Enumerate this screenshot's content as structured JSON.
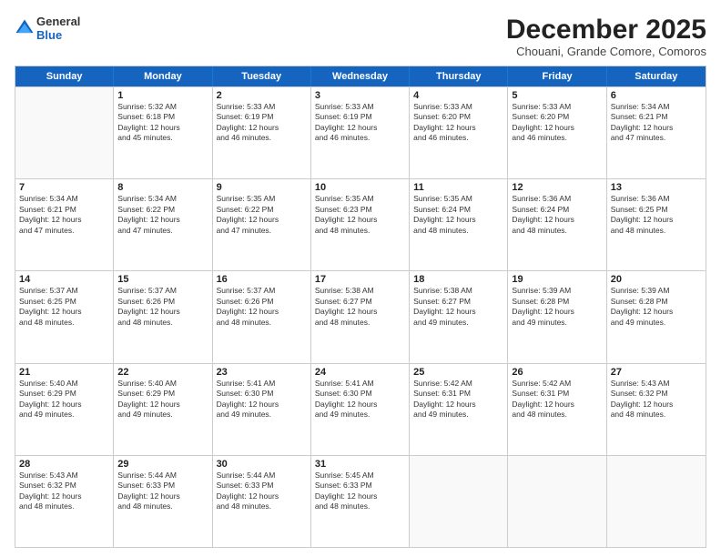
{
  "header": {
    "logo_general": "General",
    "logo_blue": "Blue",
    "main_title": "December 2025",
    "subtitle": "Chouani, Grande Comore, Comoros"
  },
  "days": [
    "Sunday",
    "Monday",
    "Tuesday",
    "Wednesday",
    "Thursday",
    "Friday",
    "Saturday"
  ],
  "rows": [
    [
      {
        "day": "",
        "content": ""
      },
      {
        "day": "1",
        "content": "Sunrise: 5:32 AM\nSunset: 6:18 PM\nDaylight: 12 hours\nand 45 minutes."
      },
      {
        "day": "2",
        "content": "Sunrise: 5:33 AM\nSunset: 6:19 PM\nDaylight: 12 hours\nand 46 minutes."
      },
      {
        "day": "3",
        "content": "Sunrise: 5:33 AM\nSunset: 6:19 PM\nDaylight: 12 hours\nand 46 minutes."
      },
      {
        "day": "4",
        "content": "Sunrise: 5:33 AM\nSunset: 6:20 PM\nDaylight: 12 hours\nand 46 minutes."
      },
      {
        "day": "5",
        "content": "Sunrise: 5:33 AM\nSunset: 6:20 PM\nDaylight: 12 hours\nand 46 minutes."
      },
      {
        "day": "6",
        "content": "Sunrise: 5:34 AM\nSunset: 6:21 PM\nDaylight: 12 hours\nand 47 minutes."
      }
    ],
    [
      {
        "day": "7",
        "content": "Sunrise: 5:34 AM\nSunset: 6:21 PM\nDaylight: 12 hours\nand 47 minutes."
      },
      {
        "day": "8",
        "content": "Sunrise: 5:34 AM\nSunset: 6:22 PM\nDaylight: 12 hours\nand 47 minutes."
      },
      {
        "day": "9",
        "content": "Sunrise: 5:35 AM\nSunset: 6:22 PM\nDaylight: 12 hours\nand 47 minutes."
      },
      {
        "day": "10",
        "content": "Sunrise: 5:35 AM\nSunset: 6:23 PM\nDaylight: 12 hours\nand 48 minutes."
      },
      {
        "day": "11",
        "content": "Sunrise: 5:35 AM\nSunset: 6:24 PM\nDaylight: 12 hours\nand 48 minutes."
      },
      {
        "day": "12",
        "content": "Sunrise: 5:36 AM\nSunset: 6:24 PM\nDaylight: 12 hours\nand 48 minutes."
      },
      {
        "day": "13",
        "content": "Sunrise: 5:36 AM\nSunset: 6:25 PM\nDaylight: 12 hours\nand 48 minutes."
      }
    ],
    [
      {
        "day": "14",
        "content": "Sunrise: 5:37 AM\nSunset: 6:25 PM\nDaylight: 12 hours\nand 48 minutes."
      },
      {
        "day": "15",
        "content": "Sunrise: 5:37 AM\nSunset: 6:26 PM\nDaylight: 12 hours\nand 48 minutes."
      },
      {
        "day": "16",
        "content": "Sunrise: 5:37 AM\nSunset: 6:26 PM\nDaylight: 12 hours\nand 48 minutes."
      },
      {
        "day": "17",
        "content": "Sunrise: 5:38 AM\nSunset: 6:27 PM\nDaylight: 12 hours\nand 48 minutes."
      },
      {
        "day": "18",
        "content": "Sunrise: 5:38 AM\nSunset: 6:27 PM\nDaylight: 12 hours\nand 49 minutes."
      },
      {
        "day": "19",
        "content": "Sunrise: 5:39 AM\nSunset: 6:28 PM\nDaylight: 12 hours\nand 49 minutes."
      },
      {
        "day": "20",
        "content": "Sunrise: 5:39 AM\nSunset: 6:28 PM\nDaylight: 12 hours\nand 49 minutes."
      }
    ],
    [
      {
        "day": "21",
        "content": "Sunrise: 5:40 AM\nSunset: 6:29 PM\nDaylight: 12 hours\nand 49 minutes."
      },
      {
        "day": "22",
        "content": "Sunrise: 5:40 AM\nSunset: 6:29 PM\nDaylight: 12 hours\nand 49 minutes."
      },
      {
        "day": "23",
        "content": "Sunrise: 5:41 AM\nSunset: 6:30 PM\nDaylight: 12 hours\nand 49 minutes."
      },
      {
        "day": "24",
        "content": "Sunrise: 5:41 AM\nSunset: 6:30 PM\nDaylight: 12 hours\nand 49 minutes."
      },
      {
        "day": "25",
        "content": "Sunrise: 5:42 AM\nSunset: 6:31 PM\nDaylight: 12 hours\nand 49 minutes."
      },
      {
        "day": "26",
        "content": "Sunrise: 5:42 AM\nSunset: 6:31 PM\nDaylight: 12 hours\nand 48 minutes."
      },
      {
        "day": "27",
        "content": "Sunrise: 5:43 AM\nSunset: 6:32 PM\nDaylight: 12 hours\nand 48 minutes."
      }
    ],
    [
      {
        "day": "28",
        "content": "Sunrise: 5:43 AM\nSunset: 6:32 PM\nDaylight: 12 hours\nand 48 minutes."
      },
      {
        "day": "29",
        "content": "Sunrise: 5:44 AM\nSunset: 6:33 PM\nDaylight: 12 hours\nand 48 minutes."
      },
      {
        "day": "30",
        "content": "Sunrise: 5:44 AM\nSunset: 6:33 PM\nDaylight: 12 hours\nand 48 minutes."
      },
      {
        "day": "31",
        "content": "Sunrise: 5:45 AM\nSunset: 6:33 PM\nDaylight: 12 hours\nand 48 minutes."
      },
      {
        "day": "",
        "content": ""
      },
      {
        "day": "",
        "content": ""
      },
      {
        "day": "",
        "content": ""
      }
    ]
  ]
}
